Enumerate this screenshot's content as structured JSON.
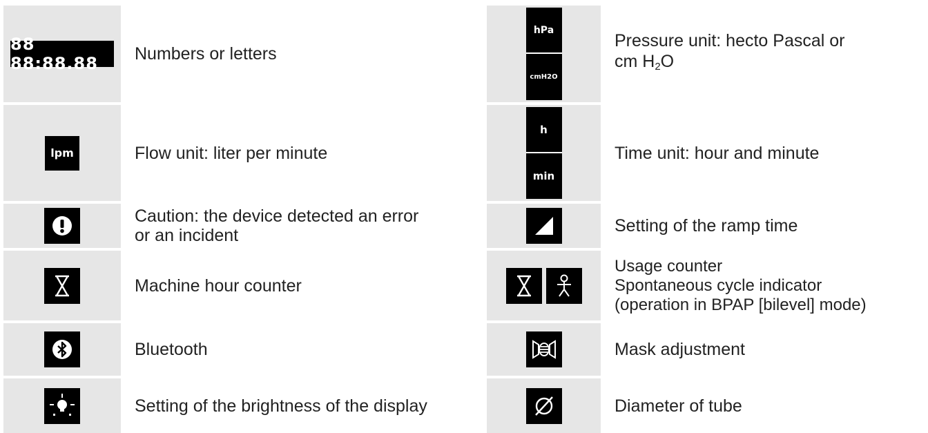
{
  "rows": [
    {
      "left": {
        "icon": "segment-display-icon",
        "glyphs": "88 88:88.88",
        "text": "Numbers or letters"
      },
      "right": {
        "icon": "pressure-unit-icon",
        "labels": [
          "hPa",
          "cmH2O"
        ],
        "text_1": "Pressure unit: hecto Pascal or",
        "text_2_pre": "cm H",
        "text_2_sub": "2",
        "text_2_post": "O"
      }
    },
    {
      "left": {
        "icon": "lpm-icon",
        "label": "lpm",
        "text": "Flow unit: liter per minute"
      },
      "right": {
        "icon": "time-unit-icon",
        "labels": [
          "h",
          "min"
        ],
        "text": "Time unit: hour and minute"
      }
    },
    {
      "left": {
        "icon": "caution-icon",
        "text": "Caution: the device detected an error or an incident"
      },
      "right": {
        "icon": "ramp-icon",
        "text": "Setting of the ramp time"
      }
    },
    {
      "left": {
        "icon": "hourglass-icon",
        "text": "Machine hour counter"
      },
      "right": {
        "icon": "usage-spontaneous-icons",
        "lines": [
          "Usage counter",
          "Spontaneous cycle indicator",
          "(operation in BPAP [bilevel] mode)"
        ]
      }
    },
    {
      "left": {
        "icon": "bluetooth-icon",
        "text": "Bluetooth"
      },
      "right": {
        "icon": "mask-icon",
        "text": "Mask adjustment"
      }
    },
    {
      "left": {
        "icon": "brightness-icon",
        "text": "Setting of the brightness of the display"
      },
      "right": {
        "icon": "diameter-icon",
        "symbol": "Ø",
        "text": "Diameter of tube"
      }
    }
  ],
  "colors": {
    "icon_bg": "#e6e6e6",
    "icon_black": "#000000",
    "text": "#222222"
  }
}
